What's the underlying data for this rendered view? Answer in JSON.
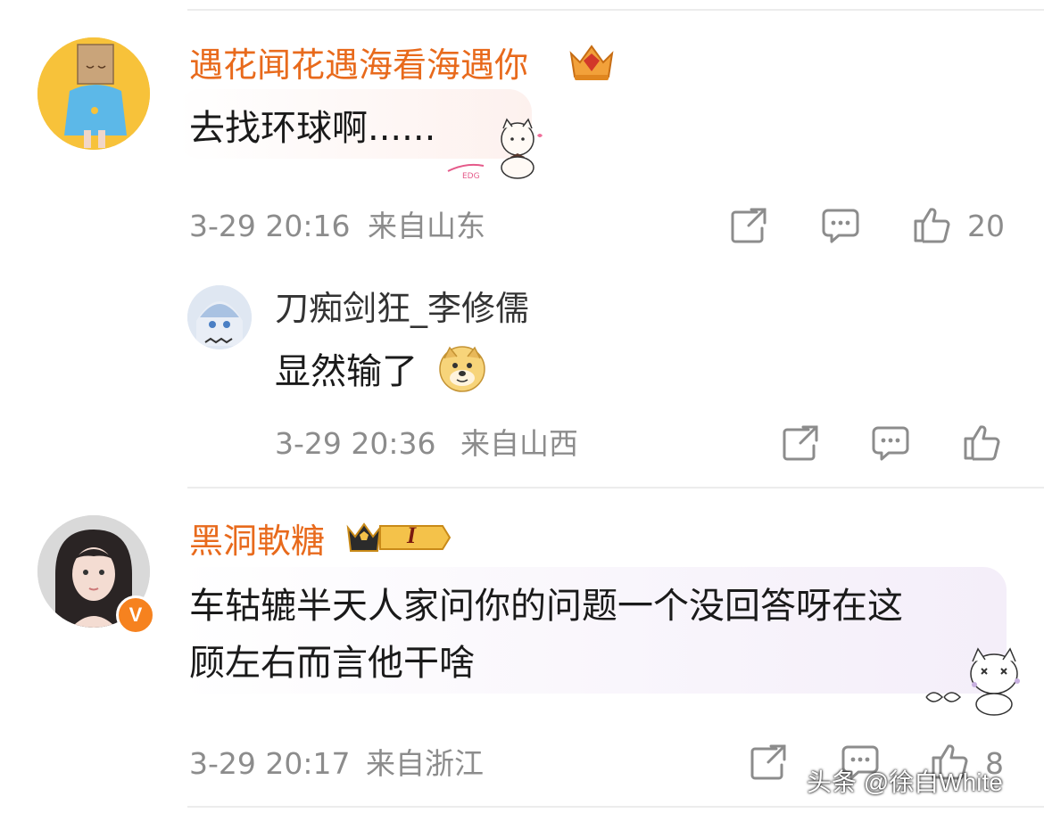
{
  "comments": [
    {
      "username": "遇花闻花遇海看海遇你",
      "text": "去找环球啊......",
      "time": "3-29 20:16",
      "location": "来自山东",
      "like_count": "20",
      "reply": {
        "username": "刀痴剑狂_李修儒",
        "text": "显然输了",
        "emoji": "doge-emoji",
        "time": "3-29 20:36",
        "location": "来自山西",
        "like_count": ""
      }
    },
    {
      "username": "黑洞軟糖",
      "text_line1": "车轱辘半天人家问你的问题一个没回答呀在这",
      "text_line2": "顾左右而言他干啥",
      "time": "3-29 20:17",
      "location": "来自浙江",
      "like_count": "8",
      "badge_text": "I",
      "verified_mark": "V"
    }
  ],
  "sticker_label": "EDG",
  "watermark": "头条 @徐白White",
  "colors": {
    "username": "#e86a1c",
    "meta": "#8c8c8c",
    "divider": "#ececec"
  }
}
